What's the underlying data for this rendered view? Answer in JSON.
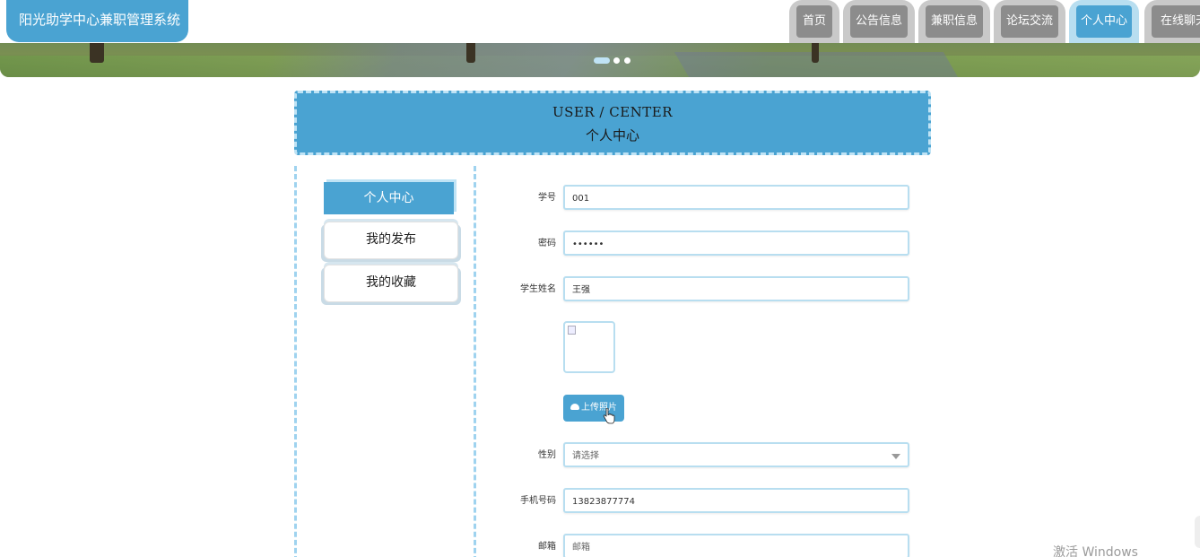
{
  "header": {
    "site_title": "阳光助学中心兼职管理系统",
    "nav": [
      {
        "label": "首页",
        "active": false
      },
      {
        "label": "公告信息",
        "active": false
      },
      {
        "label": "兼职信息",
        "active": false
      },
      {
        "label": "论坛交流",
        "active": false
      },
      {
        "label": "个人中心",
        "active": true
      },
      {
        "label": "在线聊天",
        "active": false
      }
    ],
    "carousel_active_index": 0,
    "carousel_count": 3
  },
  "page_title": {
    "en": "USER / CENTER",
    "cn": "个人中心"
  },
  "sidebar": {
    "items": [
      {
        "label": "个人中心",
        "active": true
      },
      {
        "label": "我的发布",
        "active": false
      },
      {
        "label": "我的收藏",
        "active": false
      }
    ]
  },
  "form": {
    "student_id": {
      "label": "学号",
      "value": "001"
    },
    "password": {
      "label": "密码",
      "value": "••••••"
    },
    "student_name": {
      "label": "学生姓名",
      "value": "王强"
    },
    "upload_label": "上传照片",
    "gender": {
      "label": "性别",
      "placeholder": "请选择"
    },
    "phone": {
      "label": "手机号码",
      "value": "13823877774"
    },
    "email": {
      "label": "邮箱",
      "placeholder": "邮箱"
    }
  },
  "os_watermark": "激活 Windows",
  "colors": {
    "accent": "#4aa3d2",
    "accent_light": "#b8def0",
    "nav_inactive": "#8c8c8c"
  }
}
